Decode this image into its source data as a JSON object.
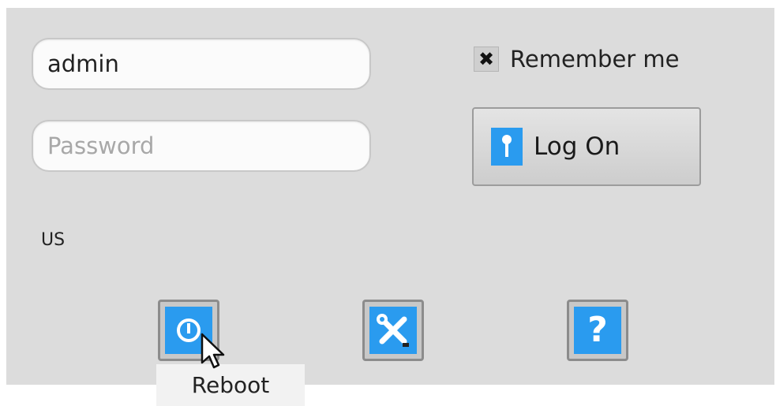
{
  "login": {
    "username_value": "admin",
    "password_placeholder": "Password",
    "remember_label": "Remember me",
    "remember_checked": true,
    "logon_label": "Log On"
  },
  "locale": "US",
  "tools": {
    "reboot_icon": "power-icon",
    "settings_icon": "tools-icon",
    "help_icon": "help-icon",
    "help_glyph": "?",
    "tooltip": "Reboot"
  },
  "colors": {
    "accent": "#2a9bef",
    "panel": "#dcdcdc"
  }
}
